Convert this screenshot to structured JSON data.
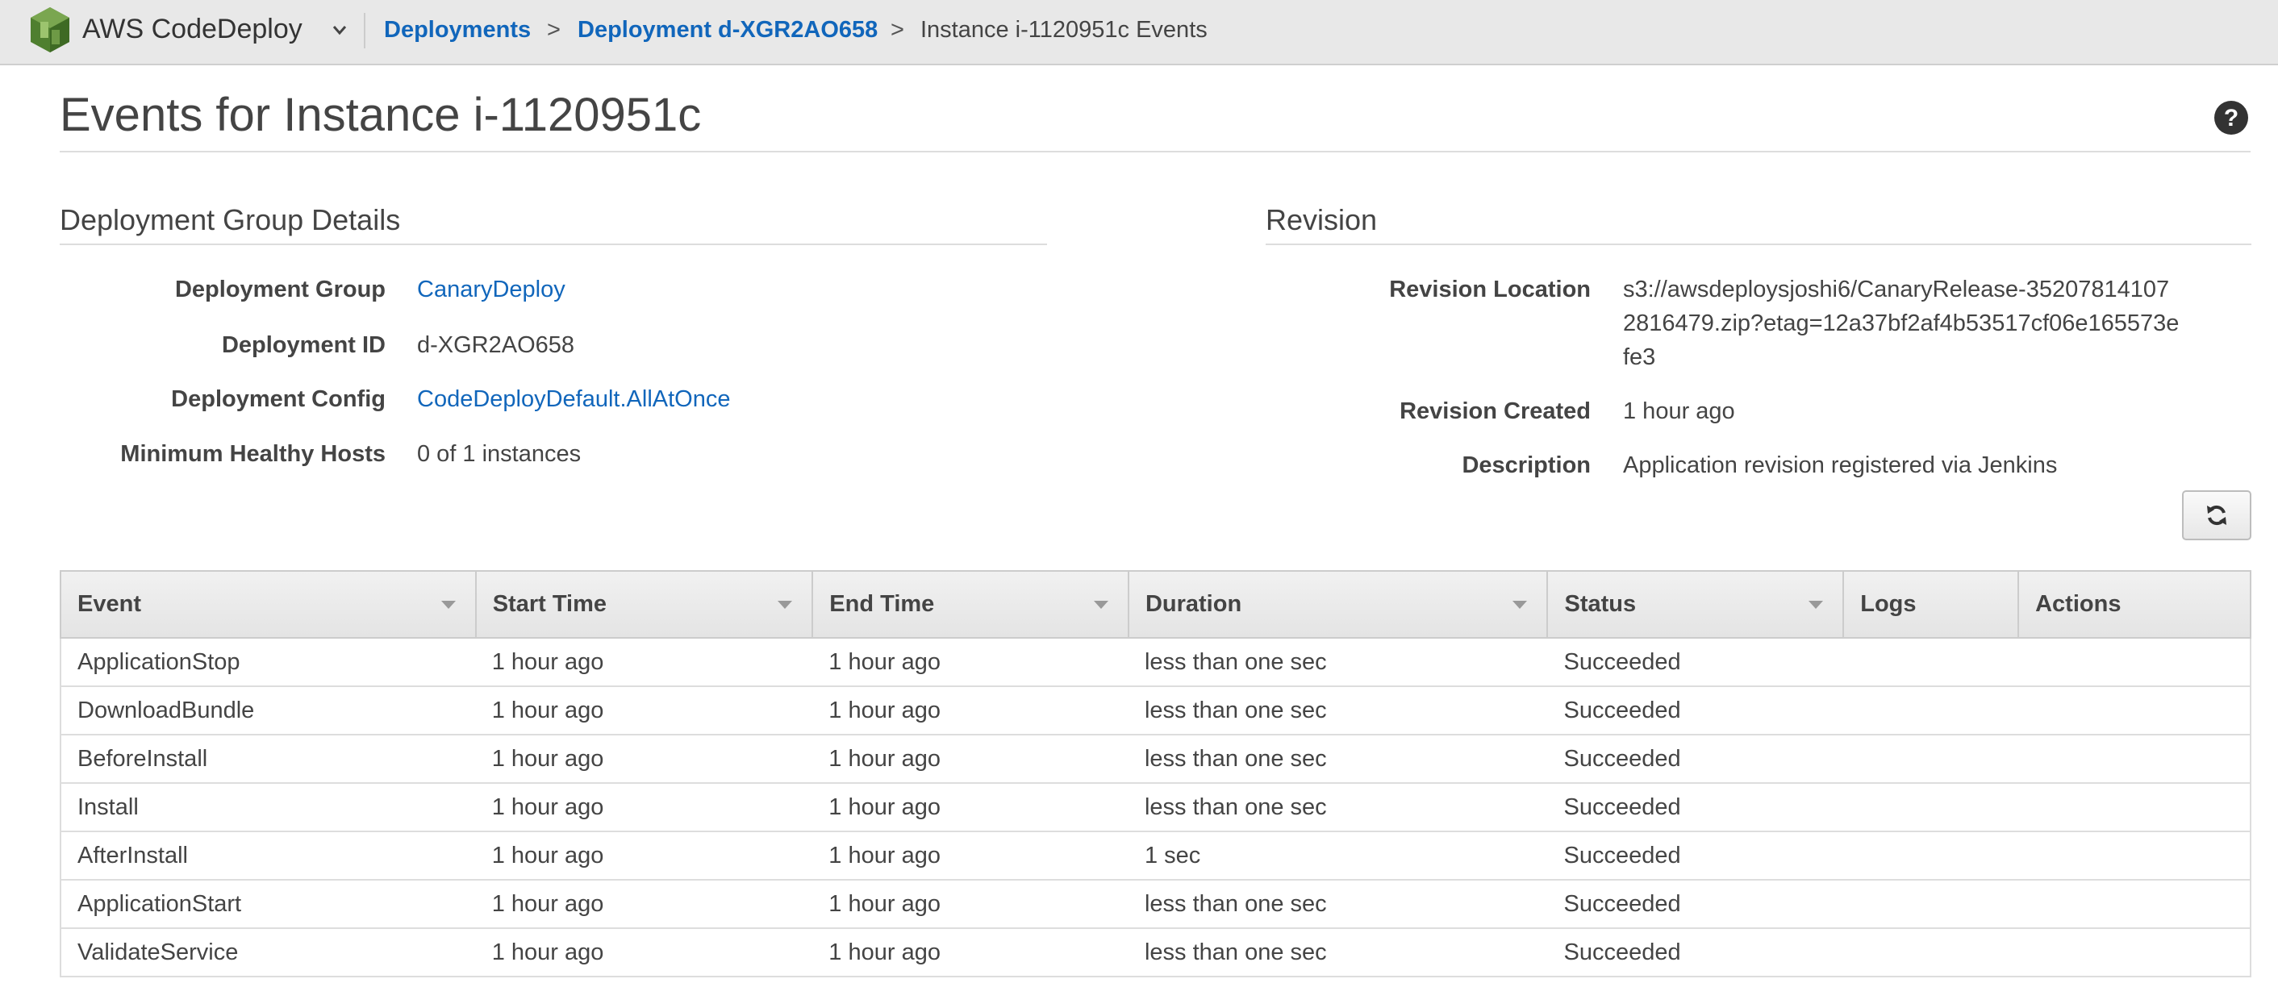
{
  "topbar": {
    "app_title": "AWS CodeDeploy",
    "breadcrumb": [
      {
        "label": "Deployments"
      },
      {
        "label": ">"
      },
      {
        "label": "Deployment d-XGR2AO658"
      },
      {
        "label": ">"
      },
      {
        "label": "Instance i-1120951c Events"
      }
    ]
  },
  "page": {
    "title": "Events for Instance i-1120951c"
  },
  "deployment_group_details": {
    "title": "Deployment Group Details",
    "rows": [
      {
        "label": "Deployment Group",
        "value": "CanaryDeploy"
      },
      {
        "label": "Deployment ID",
        "value": "d-XGR2AO658"
      },
      {
        "label": "Deployment Config",
        "value": "CodeDeployDefault.AllAtOnce"
      },
      {
        "label": "Minimum Healthy Hosts",
        "value": "0 of 1 instances"
      }
    ]
  },
  "revision": {
    "title": "Revision",
    "location_label": "Revision Location",
    "location_lines": [
      "s3://awsdeploysjoshi6/CanaryRelease-35207814107",
      "2816479.zip?etag=12a37bf2af4b53517cf06e165573e",
      "fe3"
    ],
    "created_label": "Revision Created",
    "created_value": "1 hour ago",
    "description_label": "Description",
    "description_value": "Application revision registered via Jenkins"
  },
  "table": {
    "columns": [
      "Event",
      "Start Time",
      "End Time",
      "Duration",
      "Status",
      "Logs",
      "Actions"
    ],
    "rows": [
      {
        "event": "ApplicationStop",
        "start": "1 hour ago",
        "end": "1 hour ago",
        "duration": "less than one sec",
        "status": "Succeeded",
        "logs": "",
        "actions": ""
      },
      {
        "event": "DownloadBundle",
        "start": "1 hour ago",
        "end": "1 hour ago",
        "duration": "less than one sec",
        "status": "Succeeded",
        "logs": "",
        "actions": ""
      },
      {
        "event": "BeforeInstall",
        "start": "1 hour ago",
        "end": "1 hour ago",
        "duration": "less than one sec",
        "status": "Succeeded",
        "logs": "",
        "actions": ""
      },
      {
        "event": "Install",
        "start": "1 hour ago",
        "end": "1 hour ago",
        "duration": "less than one sec",
        "status": "Succeeded",
        "logs": "",
        "actions": ""
      },
      {
        "event": "AfterInstall",
        "start": "1 hour ago",
        "end": "1 hour ago",
        "duration": "1 sec",
        "status": "Succeeded",
        "logs": "",
        "actions": ""
      },
      {
        "event": "ApplicationStart",
        "start": "1 hour ago",
        "end": "1 hour ago",
        "duration": "less than one sec",
        "status": "Succeeded",
        "logs": "",
        "actions": ""
      },
      {
        "event": "ValidateService",
        "start": "1 hour ago",
        "end": "1 hour ago",
        "duration": "less than one sec",
        "status": "Succeeded",
        "logs": "",
        "actions": ""
      }
    ]
  },
  "colors": {
    "link": "#1166bb",
    "success": "#1d9c1d",
    "topbar_bg": "#e8e8e8",
    "logo_green": "#5a8a3a"
  },
  "icons": {
    "logo": "codedeploy-logo-icon",
    "app_menu": "chevron-down-icon",
    "help": "help-icon",
    "refresh": "refresh-icon",
    "sort": "sort-caret-icon"
  }
}
